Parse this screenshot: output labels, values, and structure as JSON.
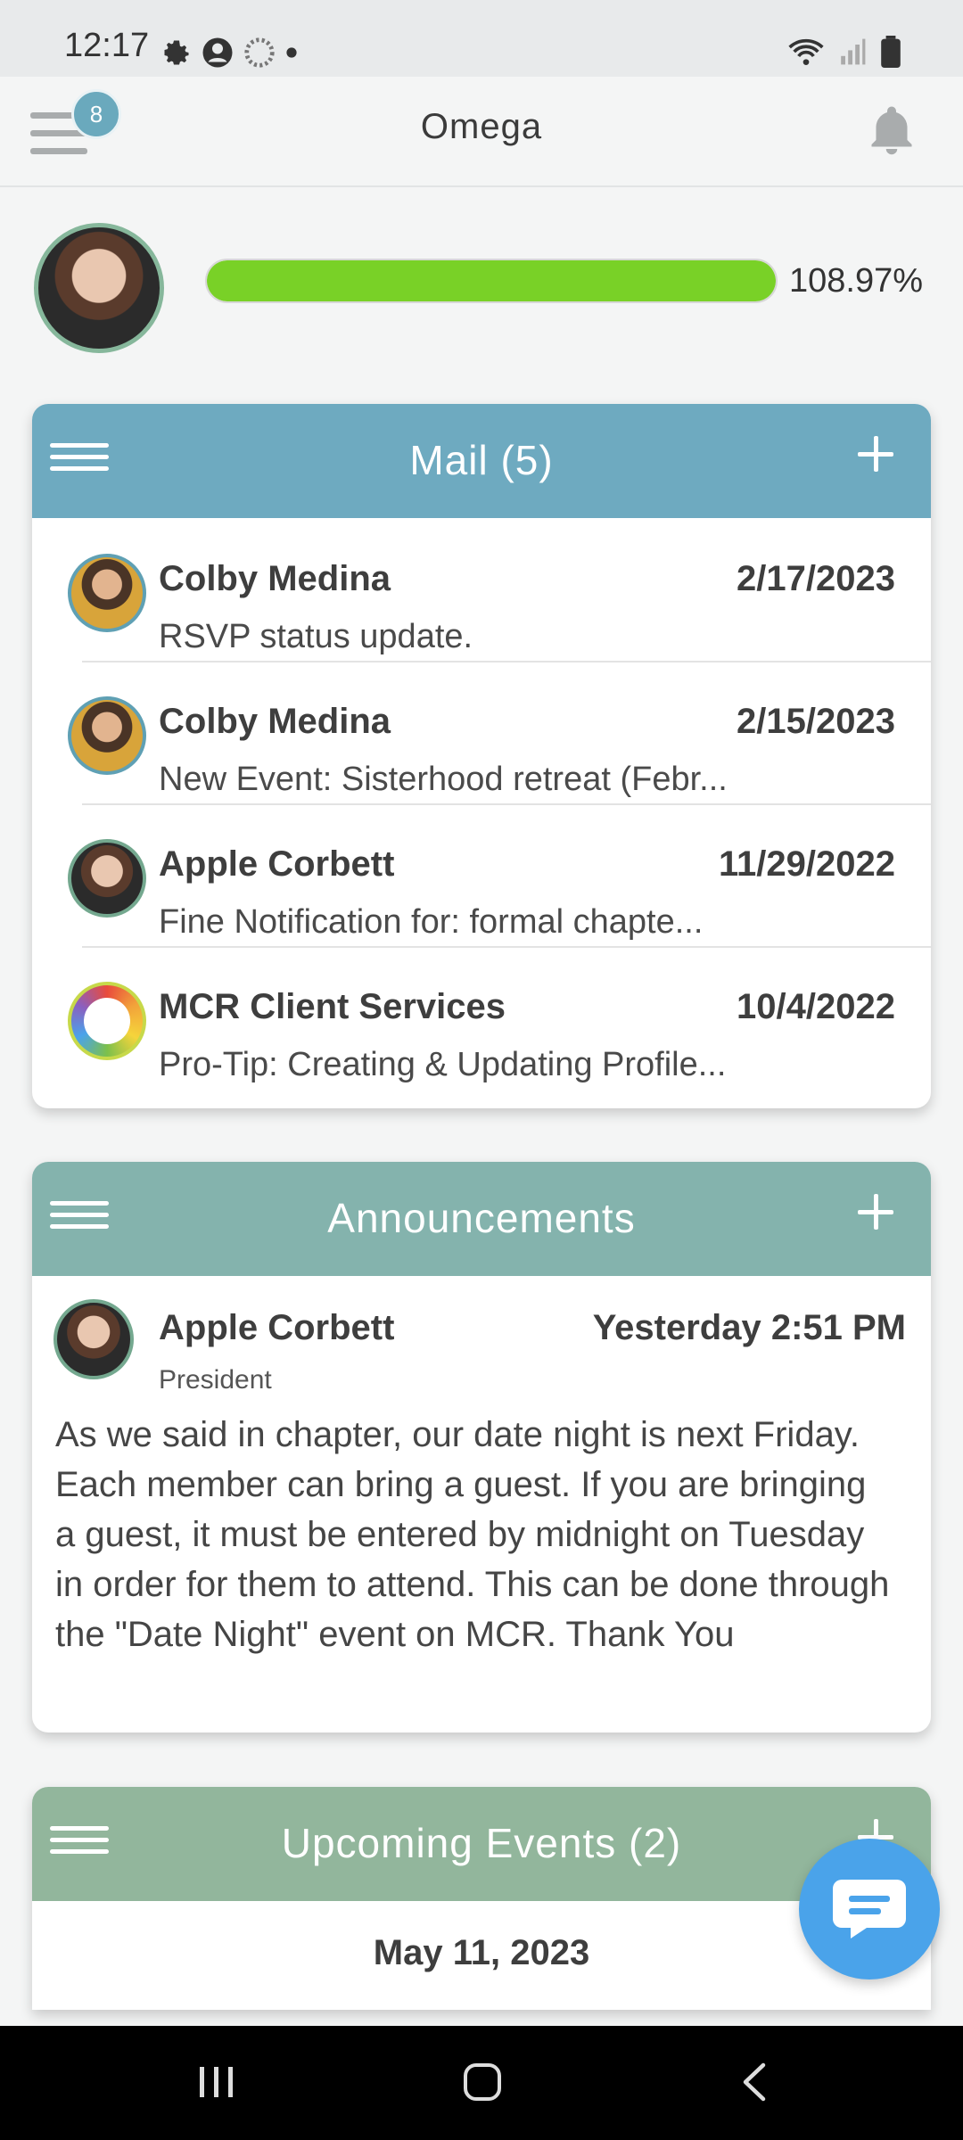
{
  "status_bar": {
    "time": "12:17",
    "icons_left": [
      "gear-icon",
      "account-circle-icon",
      "loading-icon",
      "dot-icon"
    ],
    "icons_right": [
      "wifi-icon",
      "signal-icon",
      "battery-icon"
    ]
  },
  "app_bar": {
    "title": "Omega",
    "menu_badge": "8"
  },
  "profile": {
    "progress_percent": 108.97,
    "progress_label": "108.97%"
  },
  "mail": {
    "title": "Mail (5)",
    "header_color": "#6eaac0",
    "items": [
      {
        "name": "Colby Medina",
        "date": "2/17/2023",
        "subject": "RSVP status update."
      },
      {
        "name": "Colby Medina",
        "date": "2/15/2023",
        "subject": "New Event: Sisterhood retreat (Febr..."
      },
      {
        "name": "Apple Corbett",
        "date": "11/29/2022",
        "subject": "Fine Notification for: formal chapte..."
      },
      {
        "name": "MCR Client Services",
        "date": "10/4/2022",
        "subject": "Pro-Tip: Creating & Updating Profile..."
      }
    ]
  },
  "announcements": {
    "title": "Announcements",
    "header_color": "#84b3ad",
    "author": "Apple Corbett",
    "role": "President",
    "time": "Yesterday 2:51 PM",
    "body": "As we said in chapter, our date night is next Friday. Each member can bring a guest. If you are bringing a guest, it must be entered by midnight on Tuesday in order for them to attend. This can be done through the \"Date Night\" event on MCR. Thank You"
  },
  "events": {
    "title": "Upcoming Events (2)",
    "header_color": "#92b69c",
    "first_date": "May 11, 2023"
  },
  "colors": {
    "progress_fill": "#79d127",
    "chat_fab": "#4aa3ea"
  }
}
